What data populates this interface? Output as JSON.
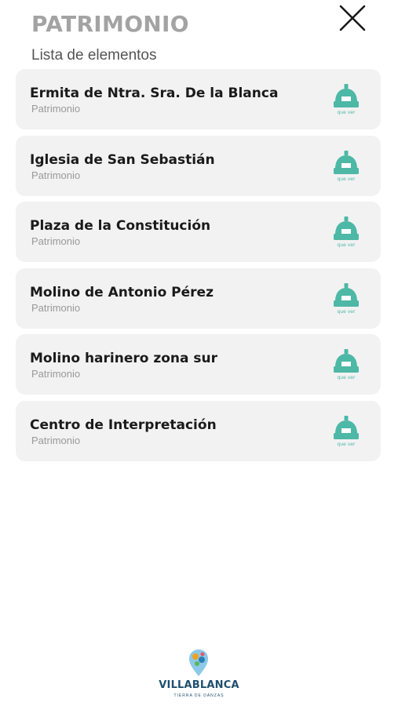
{
  "header": {
    "title": "PATRIMONIO",
    "subtitle": "Lista de elementos",
    "close_icon": "close-icon"
  },
  "items": [
    {
      "name": "Ermita de Ntra. Sra. De la Blanca",
      "category": "Patrimonio",
      "icon": "monument-icon",
      "icon_caption": "que ver"
    },
    {
      "name": "Iglesia de San Sebastián",
      "category": "Patrimonio",
      "icon": "monument-icon",
      "icon_caption": "que ver"
    },
    {
      "name": "Plaza de la Constitución",
      "category": "Patrimonio",
      "icon": "monument-icon",
      "icon_caption": "que ver"
    },
    {
      "name": "Molino de Antonio Pérez",
      "category": "Patrimonio",
      "icon": "monument-icon",
      "icon_caption": "que ver"
    },
    {
      "name": "Molino harinero zona sur",
      "category": "Patrimonio",
      "icon": "monument-icon",
      "icon_caption": "que ver"
    },
    {
      "name": "Centro de Interpretación",
      "category": "Patrimonio",
      "icon": "monument-icon",
      "icon_caption": "que ver"
    }
  ],
  "footer": {
    "brand": "VILLABLANCA",
    "tagline": "TIERRA DE DANZAS"
  },
  "colors": {
    "title": "#a3a3a3",
    "card_bg": "#f2f2f2",
    "icon_accent": "#4db8a6",
    "brand": "#1f4e6e"
  }
}
